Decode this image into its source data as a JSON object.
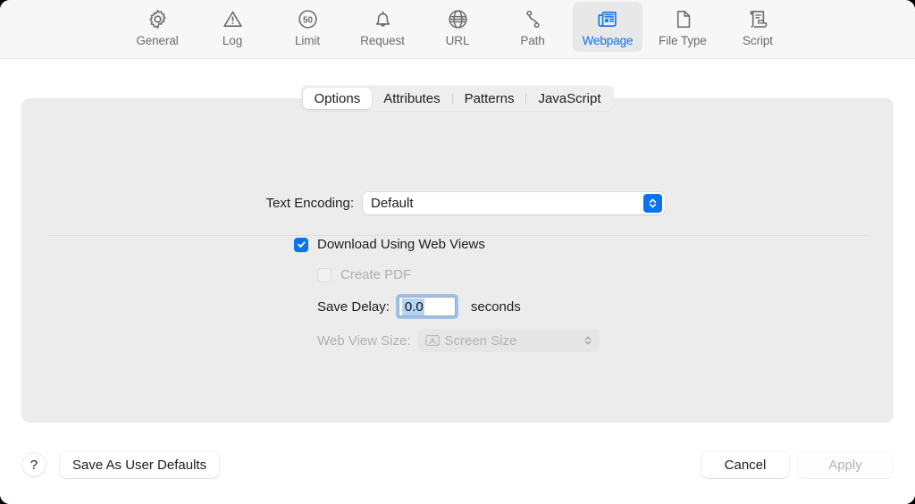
{
  "toolbar": {
    "items": [
      {
        "label": "General",
        "icon": "gear-icon",
        "selected": false
      },
      {
        "label": "Log",
        "icon": "warning-triangle-icon",
        "selected": false
      },
      {
        "label": "Limit",
        "icon": "limit-50-icon",
        "selected": false
      },
      {
        "label": "Request",
        "icon": "bell-icon",
        "selected": false
      },
      {
        "label": "URL",
        "icon": "globe-icon",
        "selected": false
      },
      {
        "label": "Path",
        "icon": "path-icon",
        "selected": false
      },
      {
        "label": "Webpage",
        "icon": "newspaper-icon",
        "selected": true
      },
      {
        "label": "File Type",
        "icon": "document-icon",
        "selected": false
      },
      {
        "label": "Script",
        "icon": "scroll-icon",
        "selected": false
      }
    ]
  },
  "tabs": {
    "items": [
      {
        "label": "Options",
        "selected": true
      },
      {
        "label": "Attributes",
        "selected": false
      },
      {
        "label": "Patterns",
        "selected": false
      },
      {
        "label": "JavaScript",
        "selected": false
      }
    ]
  },
  "form": {
    "text_encoding": {
      "label": "Text Encoding:",
      "value": "Default",
      "enabled": true
    },
    "download_web_views": {
      "label": "Download Using Web Views",
      "checked": true,
      "enabled": true
    },
    "create_pdf": {
      "label": "Create PDF",
      "checked": false,
      "enabled": false
    },
    "save_delay": {
      "label": "Save Delay:",
      "value": "0.0",
      "unit": "seconds",
      "focused": true
    },
    "web_view_size": {
      "label": "Web View Size:",
      "value": "Screen Size",
      "icon": "display-icon",
      "enabled": false
    }
  },
  "footer": {
    "help_label": "?",
    "save_defaults_label": "Save As User Defaults",
    "cancel_label": "Cancel",
    "apply_label": "Apply",
    "apply_enabled": false
  },
  "colors": {
    "accent": "#0a74f0",
    "window_bg": "#ffffff",
    "toolbar_bg": "#f7f7f7",
    "panel_bg": "#ececec",
    "text": "#1d1d1f",
    "text_disabled": "#b0b0b0",
    "selection_highlight": "#b5d3f5"
  }
}
